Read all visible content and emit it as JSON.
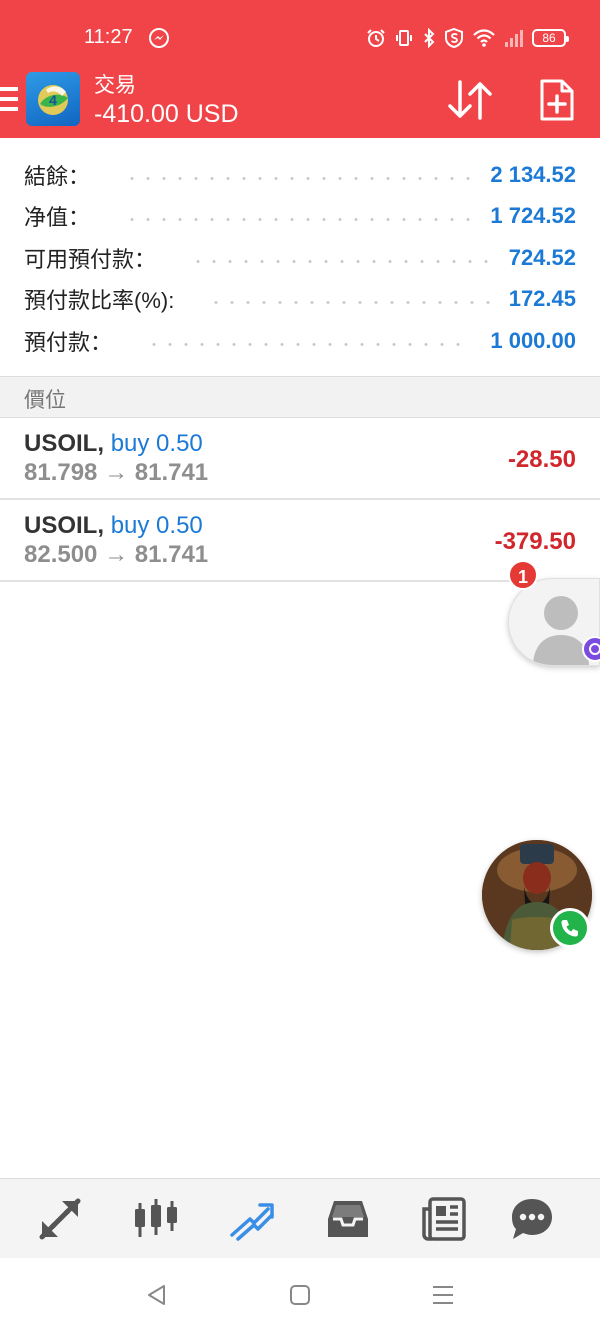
{
  "status_bar": {
    "time": "11:27",
    "battery": "86",
    "icons": [
      "messenger-icon",
      "alarm-icon",
      "vibrate-icon",
      "bluetooth-icon",
      "shield-icon",
      "wifi-icon",
      "signal-icon",
      "battery-icon"
    ]
  },
  "app_bar": {
    "title": "交易",
    "subtitle": "-410.00 USD",
    "bg_color": "#f04448",
    "icons": [
      "menu-icon",
      "metatrader-logo",
      "sort-icon",
      "new-order-icon"
    ]
  },
  "summary": [
    {
      "label": "結餘：",
      "value": "2 134.52"
    },
    {
      "label": "净值：",
      "value": "1 724.52"
    },
    {
      "label": "可用預付款：",
      "value": "724.52"
    },
    {
      "label": "預付款比率(%):",
      "value": "172.45"
    },
    {
      "label": "預付款：",
      "value": "1 000.00"
    }
  ],
  "section": {
    "title": "價位"
  },
  "positions": [
    {
      "symbol": "USOIL,",
      "side": "buy 0.50",
      "prices": "81.798 → 81.741",
      "profit": "-28.50"
    },
    {
      "symbol": "USOIL,",
      "side": "buy 0.50",
      "prices": "82.500 → 81.741",
      "profit": "-379.50"
    }
  ],
  "chat_bubble": {
    "badge": "1"
  },
  "bottom_nav": {
    "items": [
      "quotes-icon",
      "chart-icon",
      "trade-icon",
      "history-icon",
      "news-icon",
      "chat-icon"
    ],
    "active": "trade-icon",
    "active_color": "#3a8ee6",
    "icon_color": "#555555"
  },
  "colors": {
    "accent_blue": "#1c7ad6",
    "loss_red": "#d1262c"
  }
}
